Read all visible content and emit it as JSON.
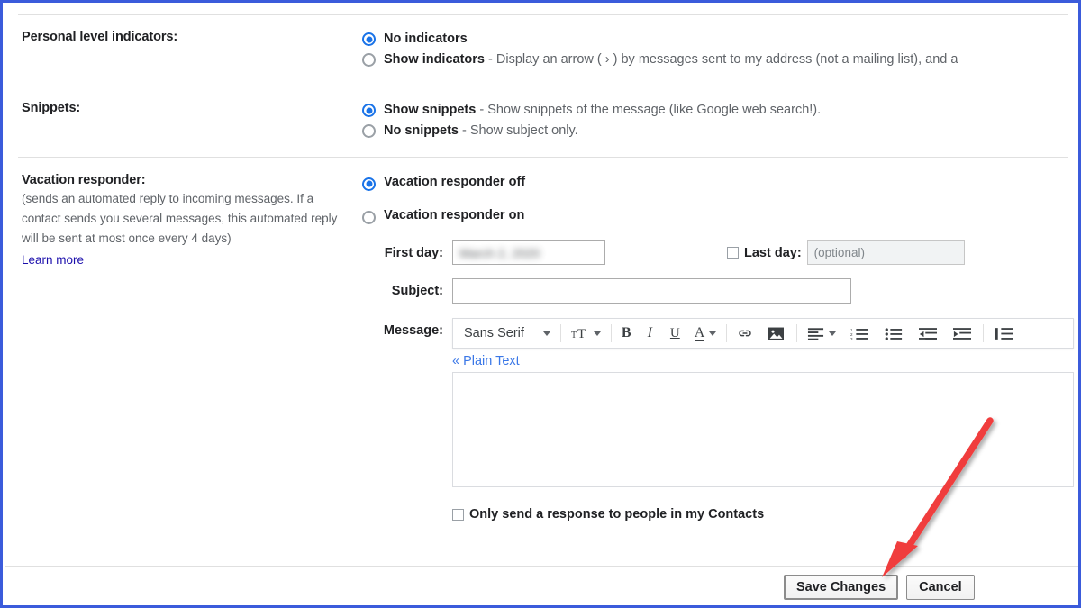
{
  "frame": {
    "border_color": "#3b5bdb"
  },
  "accent": {
    "radio_on": "#1a73e8",
    "link": "#1a0dab",
    "plain_text_link": "#3b78e7",
    "arrow": "#f03e3e"
  },
  "sections": {
    "personal_level_indicators": {
      "label": "Personal level indicators:",
      "options": [
        {
          "bold": "No indicators",
          "rest": "",
          "selected": true
        },
        {
          "bold": "Show indicators",
          "rest": " - Display an arrow ( › ) by messages sent to my address (not a mailing list), and a",
          "selected": false
        }
      ]
    },
    "snippets": {
      "label": "Snippets:",
      "options": [
        {
          "bold": "Show snippets",
          "rest": " - Show snippets of the message (like Google web search!).",
          "selected": true
        },
        {
          "bold": "No snippets",
          "rest": " - Show subject only.",
          "selected": false
        }
      ]
    },
    "vacation_responder": {
      "label": "Vacation responder:",
      "description": "(sends an automated reply to incoming messages. If a contact sends you several messages, this automated reply will be sent at most once every 4 days)",
      "learn_more": "Learn more",
      "options": [
        {
          "bold": "Vacation responder off",
          "selected": true
        },
        {
          "bold": "Vacation responder on",
          "selected": false
        }
      ],
      "first_day": {
        "label": "First day:",
        "value": "March 2, 2020",
        "blurred": true
      },
      "last_day": {
        "label": "Last day:",
        "placeholder": "(optional)",
        "checked": false
      },
      "subject": {
        "label": "Subject:",
        "value": ""
      },
      "message": {
        "label": "Message:",
        "value": ""
      },
      "plain_text_link": "« Plain Text",
      "contacts_only": {
        "label": "Only send a response to people in my Contacts",
        "checked": false
      }
    }
  },
  "toolbar": {
    "font": "Sans Serif",
    "items": [
      "font-dropdown",
      "text-size-icon",
      "bold-icon",
      "italic-icon",
      "underline-icon",
      "text-color-icon",
      "link-icon",
      "insert-image-icon",
      "align-icon",
      "numbered-list-icon",
      "bulleted-list-icon",
      "indent-less-icon",
      "indent-more-icon",
      "quote-icon"
    ]
  },
  "footer": {
    "save_label": "Save Changes",
    "cancel_label": "Cancel"
  }
}
